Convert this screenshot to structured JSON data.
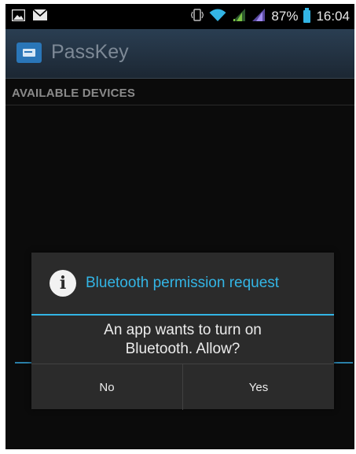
{
  "status_bar": {
    "icons": [
      "image-icon",
      "mail-icon",
      "vibrate-icon",
      "wifi-icon",
      "signal-icon",
      "signal-icon",
      "battery-icon"
    ],
    "battery_percent": "87%",
    "time": "16:04",
    "accent_color": "#33b5e5"
  },
  "action_bar": {
    "app_icon": "keycard-icon",
    "title": "PassKey"
  },
  "list": {
    "section_header": "AVAILABLE DEVICES"
  },
  "dialog": {
    "icon": "info-icon",
    "title": "Bluetooth permission request",
    "message_line1": "An app wants to turn on",
    "message_line2": "Bluetooth. Allow?",
    "negative_label": "No",
    "positive_label": "Yes",
    "title_color": "#33b5e5"
  }
}
